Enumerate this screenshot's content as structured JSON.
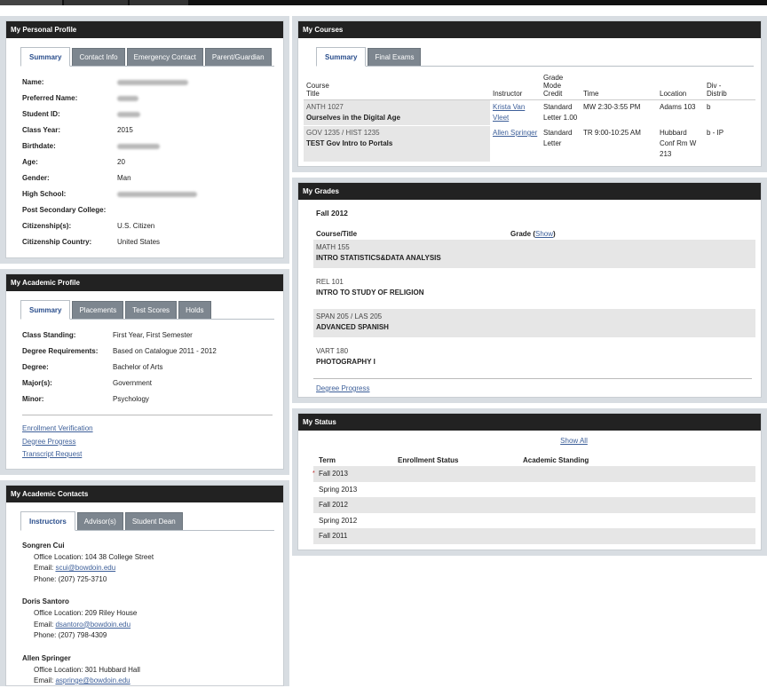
{
  "personal_profile": {
    "title": "My Personal Profile",
    "tabs": [
      "Summary",
      "Contact Info",
      "Emergency Contact",
      "Parent/Guardian"
    ],
    "fields": [
      {
        "label": "Name:",
        "value": "",
        "redacted": true,
        "w": 80
      },
      {
        "label": "Preferred Name:",
        "value": "",
        "redacted": true,
        "w": 24
      },
      {
        "label": "Student ID:",
        "value": "",
        "redacted": true,
        "w": 26
      },
      {
        "label": "Class Year:",
        "value": "2015",
        "redacted": false
      },
      {
        "label": "Birthdate:",
        "value": "",
        "redacted": true,
        "w": 48
      },
      {
        "label": "Age:",
        "value": "20",
        "redacted": false
      },
      {
        "label": "Gender:",
        "value": "Man",
        "redacted": false
      },
      {
        "label": "High School:",
        "value": "",
        "redacted": true,
        "w": 90
      },
      {
        "label": "Post Secondary College:",
        "value": "",
        "redacted": false
      },
      {
        "label": "Citizenship(s):",
        "value": "U.S. Citizen",
        "redacted": false
      },
      {
        "label": "Citizenship Country:",
        "value": "United States",
        "redacted": false
      }
    ]
  },
  "academic_profile": {
    "title": "My Academic Profile",
    "tabs": [
      "Summary",
      "Placements",
      "Test Scores",
      "Holds"
    ],
    "fields": [
      {
        "label": "Class Standing:",
        "value": "First Year, First Semester"
      },
      {
        "label": "Degree Requirements:",
        "value": "Based on Catalogue 2011 - 2012"
      },
      {
        "label": "Degree:",
        "value": "Bachelor of Arts"
      },
      {
        "label": "Major(s):",
        "value": "Government"
      },
      {
        "label": "Minor:",
        "value": "Psychology"
      }
    ],
    "links": [
      "Enrollment Verification",
      "Degree Progress",
      "Transcript Request"
    ]
  },
  "academic_contacts": {
    "title": "My Academic Contacts",
    "tabs": [
      "Instructors",
      "Advisor(s)",
      "Student Dean"
    ],
    "contacts": [
      {
        "name": "Songren Cui",
        "office": "Office Location: 104 38 College Street",
        "email_label": "Email: ",
        "email": "scui@bowdoin.edu",
        "phone": "Phone: (207) 725-3710"
      },
      {
        "name": "Doris Santoro",
        "office": "Office Location: 209 Riley House",
        "email_label": "Email: ",
        "email": "dsantoro@bowdoin.edu",
        "phone": "Phone: (207) 798-4309"
      },
      {
        "name": "Allen Springer",
        "office": "Office Location: 301 Hubbard Hall",
        "email_label": "Email: ",
        "email": "aspringe@bowdoin.edu",
        "phone": ""
      }
    ]
  },
  "courses": {
    "title": "My Courses",
    "tabs": [
      "Summary",
      "Final Exams"
    ],
    "headers": {
      "course_top": "Course",
      "course_bottom": "Title",
      "instructor": "Instructor",
      "grade_mode": "Grade\nMode\nCredit",
      "time": "Time",
      "location": "Location",
      "div": "Div -\nDistrib"
    },
    "rows": [
      {
        "code": "ANTH 1027",
        "title": "Ourselves in the Digital Age",
        "instructor": "Krista Van Vleet",
        "mode": "Standard Letter 1.00",
        "time": "MW 2:30-3:55 PM",
        "location": "Adams 103",
        "div": "b"
      },
      {
        "code": "GOV 1235 / HIST 1235",
        "title": "TEST Gov Intro to Portals",
        "instructor": "Allen Springer",
        "mode": "Standard Letter",
        "time": "TR 9:00-10:25 AM",
        "location": "Hubbard Conf Rm W 213",
        "div": "b - IP"
      }
    ]
  },
  "grades": {
    "title": "My Grades",
    "term": "Fall 2012",
    "col_course": "Course/Title",
    "col_grade": "Grade (",
    "show_label": "Show",
    "col_grade_close": ")",
    "rows": [
      {
        "code": "MATH 155",
        "title": "INTRO STATISTICS&DATA ANALYSIS"
      },
      {
        "code": "REL 101",
        "title": "INTRO TO STUDY OF RELIGION"
      },
      {
        "code": "SPAN 205 / LAS 205",
        "title": "ADVANCED SPANISH"
      },
      {
        "code": "VART 180",
        "title": "PHOTOGRAPHY I"
      }
    ],
    "link": "Degree Progress"
  },
  "status": {
    "title": "My Status",
    "show_all": "Show All",
    "col_term": "Term",
    "col_enroll": "Enrollment Status",
    "col_standing": "Academic Standing",
    "rows": [
      "Fall 2013",
      "Spring 2013",
      "Fall 2012",
      "Spring 2012",
      "Fall 2011"
    ]
  }
}
